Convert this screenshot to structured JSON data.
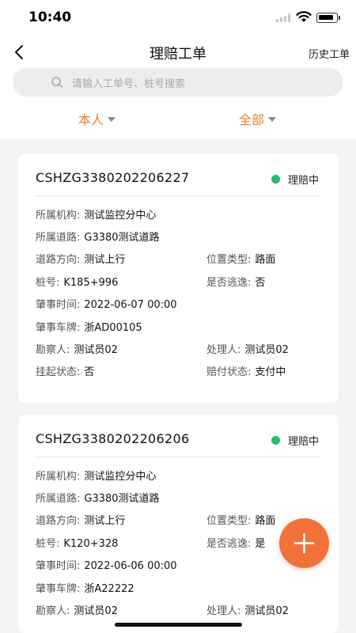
{
  "status_bar": {
    "time": "10:40"
  },
  "nav": {
    "title": "理赔工单",
    "history_label": "历史工单"
  },
  "search": {
    "placeholder": "请输入工单号、桩号搜索"
  },
  "filters": [
    {
      "label": "本人"
    },
    {
      "label": "全部"
    }
  ],
  "colors": {
    "accent": "#e58432",
    "status_green": "#2dbb6c",
    "fab": "#f0723a"
  },
  "icons": {
    "back": "chevron-left-icon",
    "search": "search-icon",
    "fab": "plus-icon"
  },
  "cards": [
    {
      "number": "CSHZG3380202206227",
      "status": "理赔中",
      "org_label": "所属机构:",
      "org": "测试监控分中心",
      "road_label": "所属道路:",
      "road": "G3380测试道路",
      "direction_label": "道路方向:",
      "direction": "测试上行",
      "location_type_label": "位置类型:",
      "location_type": "路面",
      "stake_label": "桩号:",
      "stake": "K185+996",
      "escape_label": "是否逃逸:",
      "escape": "否",
      "time_label": "肇事时间:",
      "time": "2022-06-07 00:00",
      "plate_label": "肇事车牌:",
      "plate": "浙AD00105",
      "surveyor_label": "勘察人:",
      "surveyor": "测试员02",
      "handler_label": "处理人:",
      "handler": "测试员02",
      "suspend_label": "挂起状态:",
      "suspend": "否",
      "payment_label": "赔付状态:",
      "payment": "支付中"
    },
    {
      "number": "CSHZG3380202206206",
      "status": "理赔中",
      "org_label": "所属机构:",
      "org": "测试监控分中心",
      "road_label": "所属道路:",
      "road": "G3380测试道路",
      "direction_label": "道路方向:",
      "direction": "测试上行",
      "location_type_label": "位置类型:",
      "location_type": "路面",
      "stake_label": "桩号:",
      "stake": "K120+328",
      "escape_label": "是否逃逸:",
      "escape": "是",
      "time_label": "肇事时间:",
      "time": "2022-06-06 00:00",
      "plate_label": "肇事车牌:",
      "plate": "浙A22222",
      "surveyor_label": "勘察人:",
      "surveyor": "测试员02",
      "handler_label": "处理人:",
      "handler": "测试员02"
    }
  ]
}
